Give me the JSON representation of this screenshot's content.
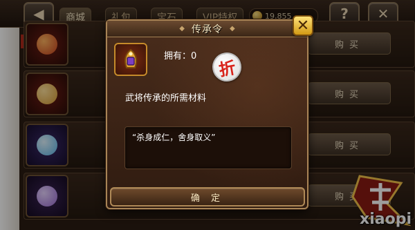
{
  "topbar": {
    "back_icon": "back-arrow-icon",
    "tabs": [
      "商城",
      "礼包",
      "宝石",
      "VIP特权"
    ],
    "gold_amount": "19,855",
    "help_label": "?",
    "close_label": "✕"
  },
  "shop": {
    "buy_label": "购买",
    "rows": [
      {
        "orb_color": "#c8431e"
      },
      {
        "orb_color": "#d79b34"
      },
      {
        "orb_color": "#5bb5e8"
      },
      {
        "orb_color": "#9a6bd0"
      }
    ]
  },
  "dialog": {
    "title": "传承令",
    "owned_text": "拥有：0",
    "discount_badge": "折",
    "description": "武将传承的所需材料",
    "quote": "“杀身成仁，舍身取义”",
    "confirm_label": "确 定",
    "close_icon": "close-x-icon"
  },
  "watermark": {
    "text": "xiaopi"
  },
  "colors": {
    "accent_gold": "#d39a14",
    "discount_red": "#d8231b"
  }
}
